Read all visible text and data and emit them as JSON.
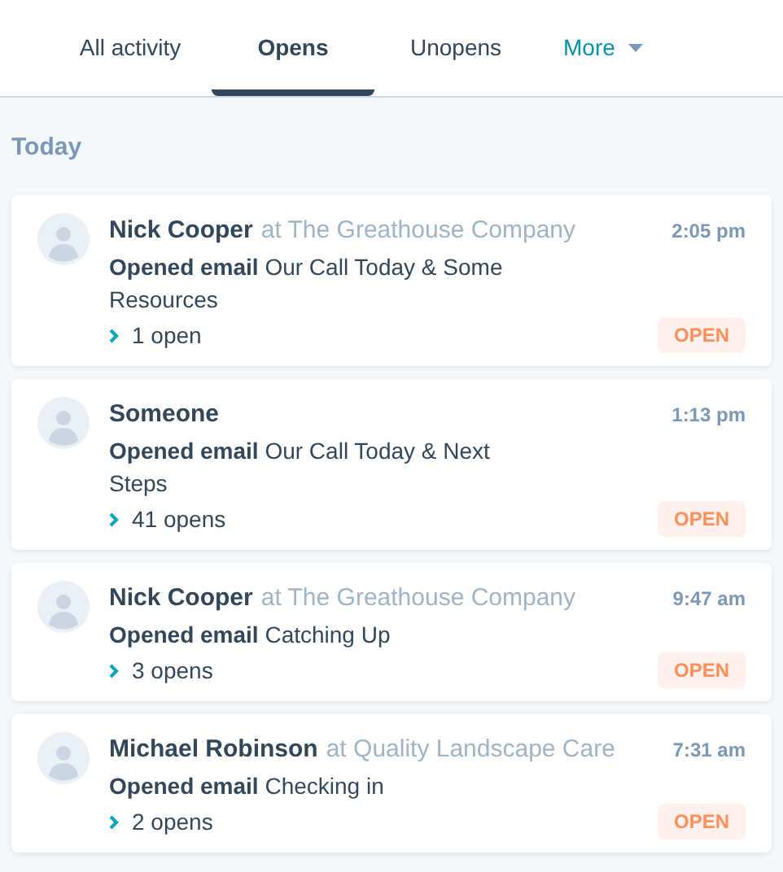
{
  "tabs": [
    {
      "label": "All activity",
      "selected": false,
      "kind": "tab"
    },
    {
      "label": "Opens",
      "selected": true,
      "kind": "tab"
    },
    {
      "label": "Unopens",
      "selected": false,
      "kind": "tab"
    },
    {
      "label": "More",
      "selected": false,
      "kind": "menu"
    }
  ],
  "section_title": "Today",
  "activities": [
    {
      "name": "Nick Cooper",
      "company": "at The Greathouse Company",
      "time": "2:05 pm",
      "action": "Opened email",
      "subject": "Our Call Today & Some Resources",
      "opens": "1 open",
      "badge": "OPEN"
    },
    {
      "name": "Someone",
      "time": "1:13 pm",
      "action": "Opened email",
      "subject": "Our Call Today & Next Steps",
      "opens": "41 opens",
      "badge": "OPEN"
    },
    {
      "name": "Nick Cooper",
      "company": "at The Greathouse Company",
      "time": "9:47 am",
      "action": "Opened email",
      "subject": "Catching Up",
      "opens": "3 opens",
      "badge": "OPEN"
    },
    {
      "name": "Michael Robinson",
      "company": "at Quality Landscape Care",
      "time": "7:31 am",
      "action": "Opened email",
      "subject": "Checking in",
      "opens": "2 opens",
      "badge": "OPEN"
    }
  ]
}
